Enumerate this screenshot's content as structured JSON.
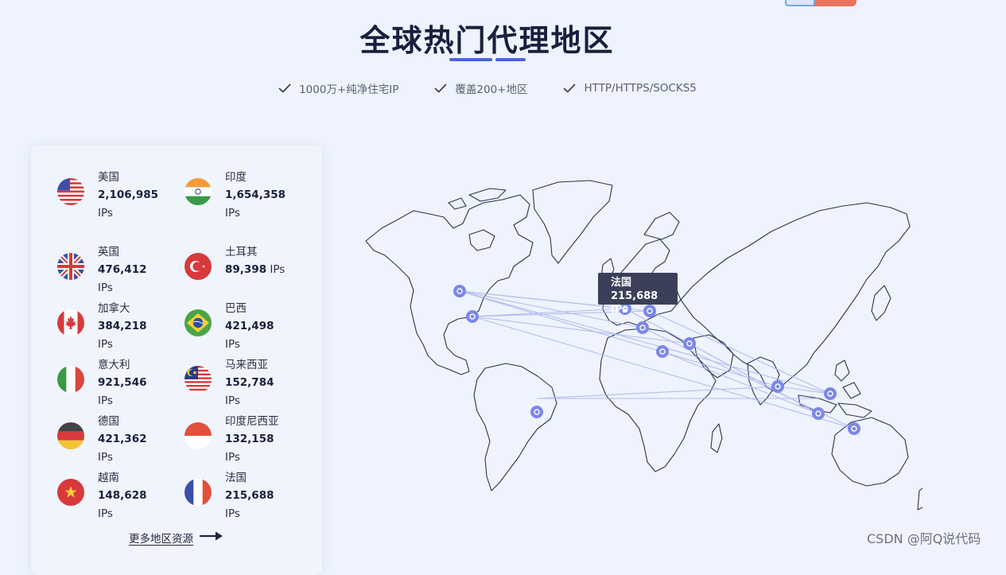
{
  "header": {
    "title": "全球热门代理地区",
    "features": [
      "1000万+纯净住宅IP",
      "覆盖200+地区",
      "HTTP/HTTPS/SOCKS5"
    ]
  },
  "colors": {
    "accent": "#4d62e0",
    "node": "#7b88e8",
    "tooltip_bg": "#3b3f59"
  },
  "regions": [
    {
      "name": "美国",
      "count": "2,106,985",
      "unit": "IPs",
      "flag": "us-flag-icon"
    },
    {
      "name": "印度",
      "count": "1,654,358",
      "unit": "IPs",
      "flag": "india-flag-icon"
    },
    {
      "name": "英国",
      "count": "476,412",
      "unit": "IPs",
      "flag": "uk-flag-icon"
    },
    {
      "name": "土耳其",
      "count": "89,398",
      "unit": "IPs",
      "flag": "turkey-flag-icon"
    },
    {
      "name": "加拿大",
      "count": "384,218",
      "unit": "IPs",
      "flag": "canada-flag-icon"
    },
    {
      "name": "巴西",
      "count": "421,498",
      "unit": "IPs",
      "flag": "brazil-flag-icon"
    },
    {
      "name": "意大利",
      "count": "921,546",
      "unit": "IPs",
      "flag": "italy-flag-icon"
    },
    {
      "name": "马来西亚",
      "count": "152,784",
      "unit": "IPs",
      "flag": "malaysia-flag-icon"
    },
    {
      "name": "德国",
      "count": "421,362",
      "unit": "IPs",
      "flag": "germany-flag-icon"
    },
    {
      "name": "印度尼西亚",
      "count": "132,158",
      "unit": "IPs",
      "flag": "indonesia-flag-icon"
    },
    {
      "name": "越南",
      "count": "148,628",
      "unit": "IPs",
      "flag": "vietnam-flag-icon"
    },
    {
      "name": "法国",
      "count": "215,688",
      "unit": "IPs",
      "flag": "france-flag-icon"
    }
  ],
  "more_link": "更多地区资源",
  "tooltip": {
    "name": "法国",
    "count": "215,688",
    "unit": "IPs"
  },
  "watermark": "CSDN @阿Q说代码"
}
